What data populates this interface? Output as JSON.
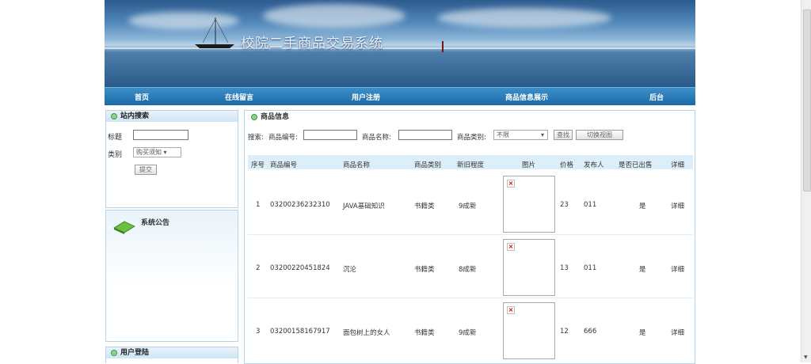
{
  "banner": {
    "title": "校院二手商品交易系统"
  },
  "nav": [
    "首页",
    "在线留言",
    "用户注册",
    "商品信息展示",
    "后台"
  ],
  "search_box": {
    "header": "站内搜索",
    "title_label": "标题",
    "category_label": "类别",
    "category_value": "购买须知",
    "submit_label": "提交"
  },
  "notice_box": {
    "header": "系统公告"
  },
  "login_box": {
    "header": "用户登陆"
  },
  "goods": {
    "header": "商品信息",
    "filter": {
      "search_label": "搜索:",
      "code_label": "商品编号:",
      "name_label": "商品名称:",
      "type_label": "商品类别:",
      "type_value": "不限",
      "find_button": "查找",
      "switch_button": "切换视图"
    },
    "columns": [
      "序号",
      "商品编号",
      "商品名称",
      "商品类别",
      "新旧程度",
      "图片",
      "价格",
      "发布人",
      "是否已出售",
      "详细"
    ],
    "rows": [
      {
        "no": "1",
        "code": "03200236232310",
        "name": "JAVA基础知识",
        "type": "书籍类",
        "condition": "9成新",
        "price": "23",
        "publisher": "011",
        "sold": "是",
        "detail": "详细"
      },
      {
        "no": "2",
        "code": "03200220451824",
        "name": "沉沦",
        "type": "书籍类",
        "condition": "8成新",
        "price": "13",
        "publisher": "011",
        "sold": "是",
        "detail": "详细"
      },
      {
        "no": "3",
        "code": "03200158167917",
        "name": "面包树上的女人",
        "type": "书籍类",
        "condition": "9成新",
        "price": "12",
        "publisher": "666",
        "sold": "是",
        "detail": "详细"
      }
    ]
  }
}
